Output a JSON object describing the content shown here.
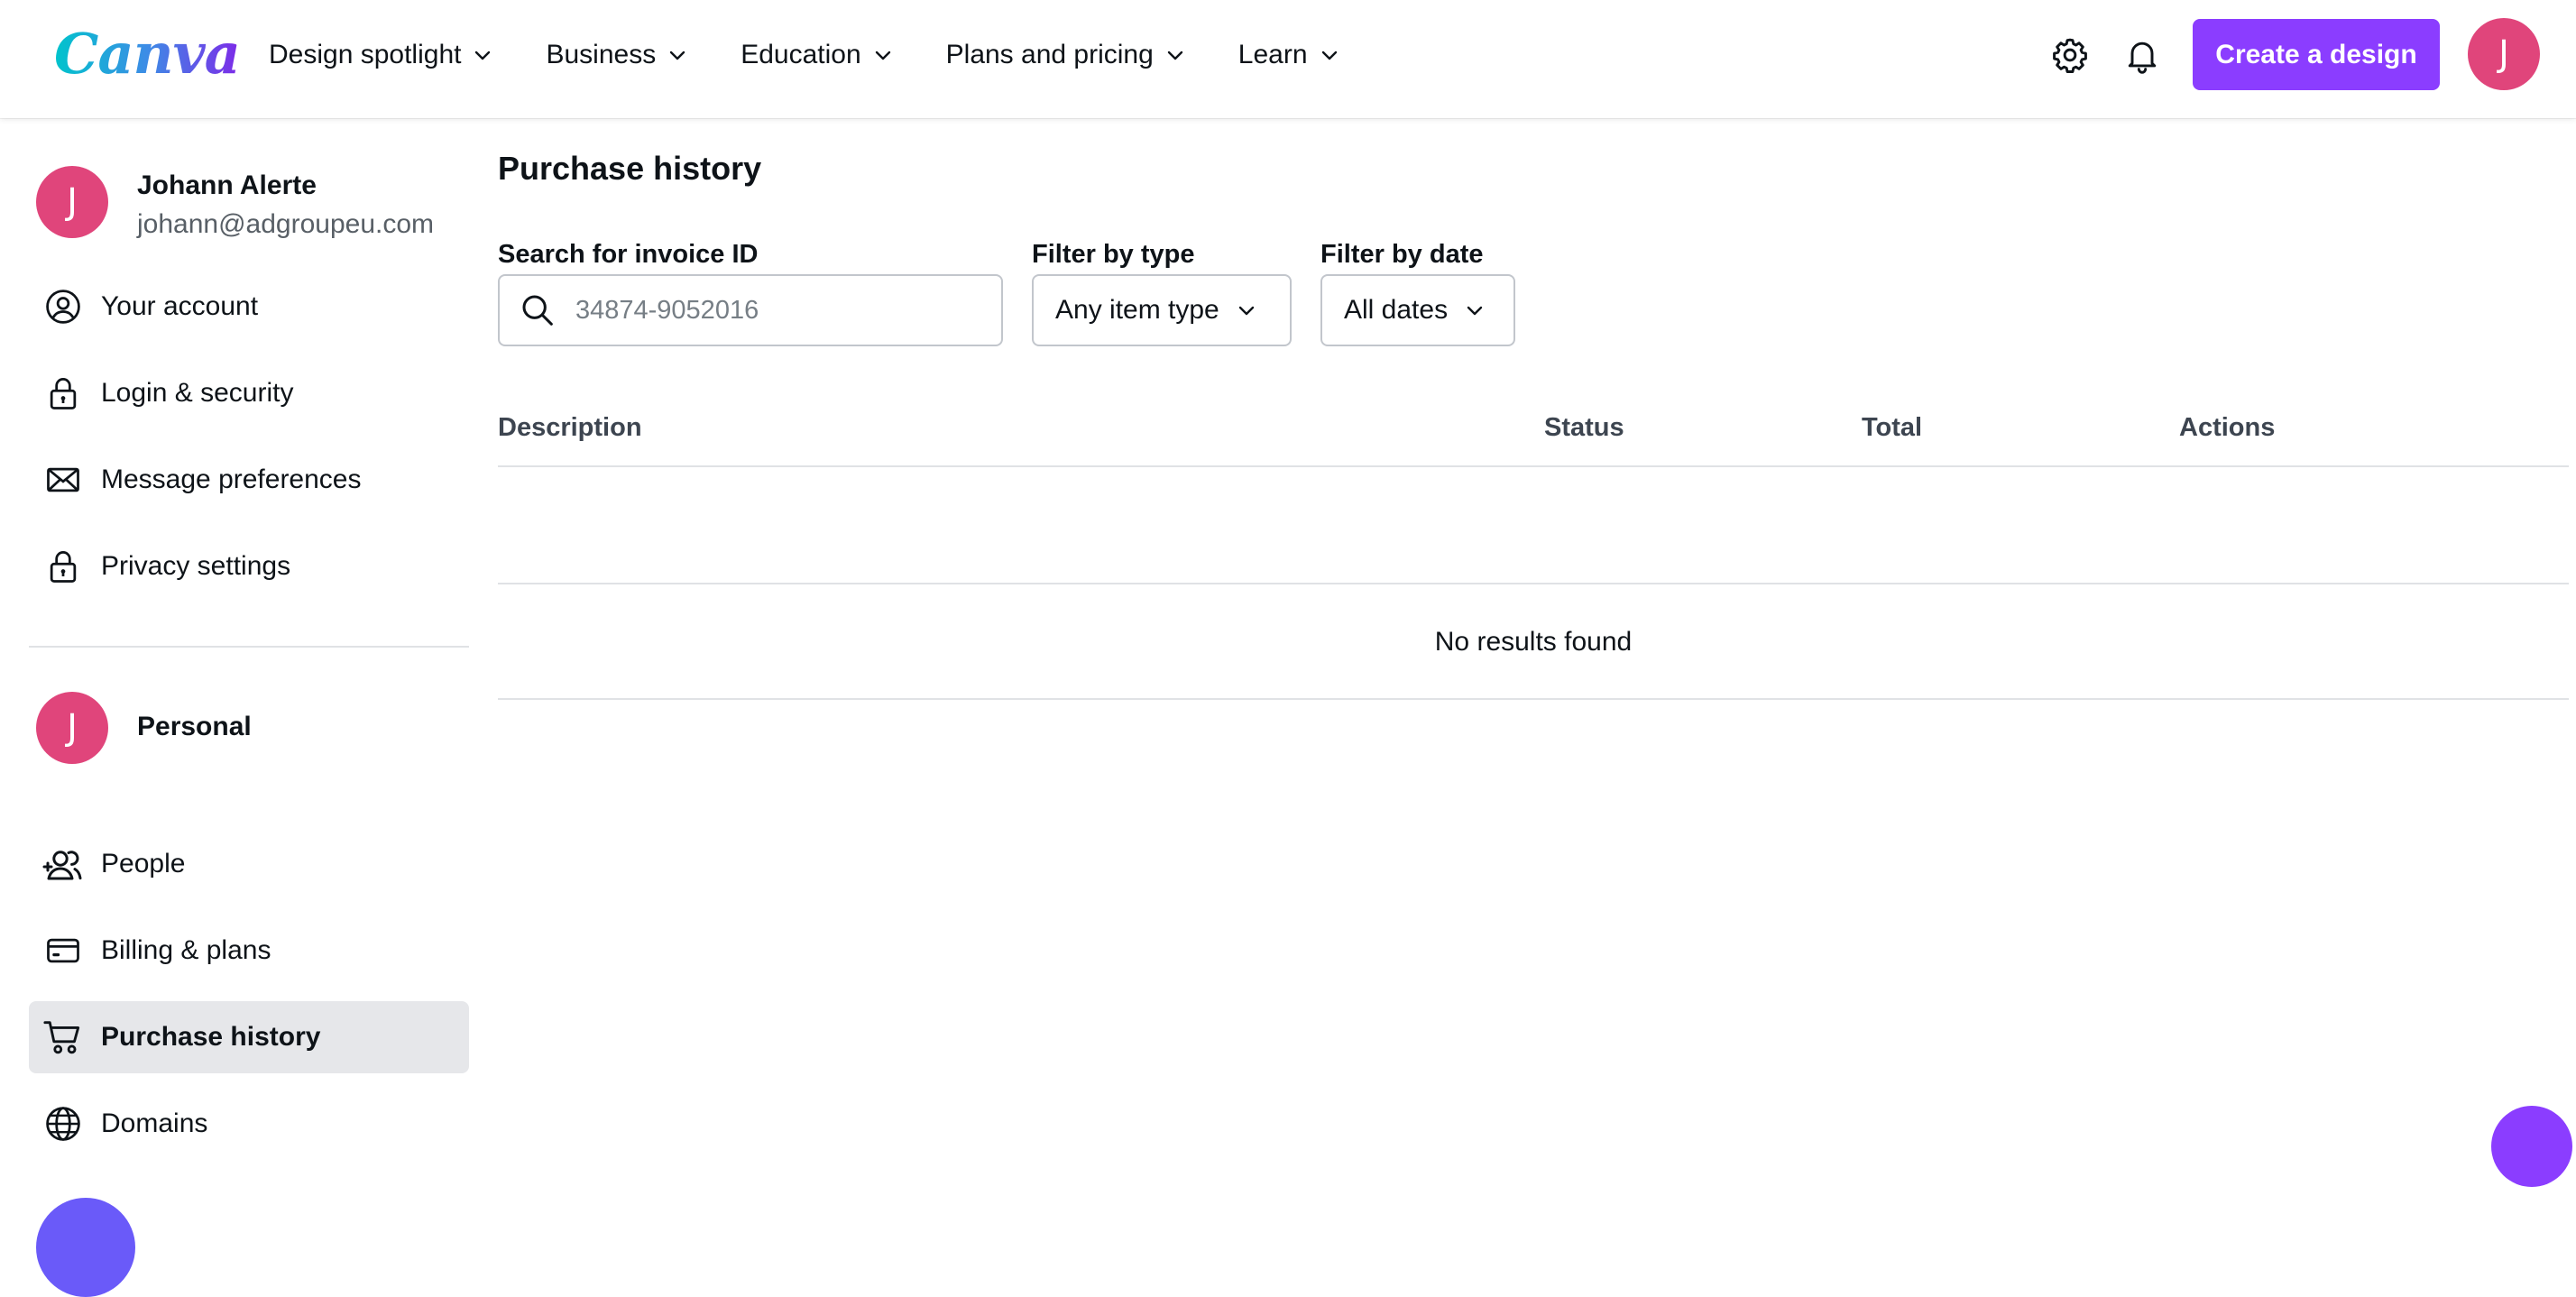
{
  "header": {
    "logo_text": "Canva",
    "nav": [
      {
        "label": "Design spotlight"
      },
      {
        "label": "Business"
      },
      {
        "label": "Education"
      },
      {
        "label": "Plans and pricing"
      },
      {
        "label": "Learn"
      }
    ],
    "settings_icon": "gear-icon",
    "notifications_icon": "bell-icon",
    "create_label": "Create a design",
    "avatar_initial": "J"
  },
  "sidebar": {
    "user": {
      "initial": "J",
      "name": "Johann Alerte",
      "email": "johann@adgroupeu.com"
    },
    "account_items": [
      {
        "label": "Your account",
        "icon": "user-circle-icon"
      },
      {
        "label": "Login & security",
        "icon": "lock-icon"
      },
      {
        "label": "Message preferences",
        "icon": "envelope-icon"
      },
      {
        "label": "Privacy settings",
        "icon": "lock-icon"
      }
    ],
    "team": {
      "initial": "J",
      "name": "Personal"
    },
    "team_items": [
      {
        "label": "People",
        "icon": "add-people-icon"
      },
      {
        "label": "Billing & plans",
        "icon": "credit-card-icon"
      },
      {
        "label": "Purchase history",
        "icon": "cart-icon",
        "active": true
      },
      {
        "label": "Domains",
        "icon": "globe-icon"
      }
    ]
  },
  "main": {
    "title": "Purchase history",
    "search": {
      "label": "Search for invoice ID",
      "placeholder": "34874-9052016",
      "value": ""
    },
    "filter_type": {
      "label": "Filter by type",
      "selected": "Any item type"
    },
    "filter_date": {
      "label": "Filter by date",
      "selected": "All dates"
    },
    "table": {
      "columns": [
        "Description",
        "Status",
        "Total",
        "Actions"
      ],
      "rows": [],
      "empty_message": "No results found"
    }
  },
  "colors": {
    "accent": "#8b3dff",
    "avatar": "#e0457b",
    "active_bg": "#e6e7ea"
  }
}
